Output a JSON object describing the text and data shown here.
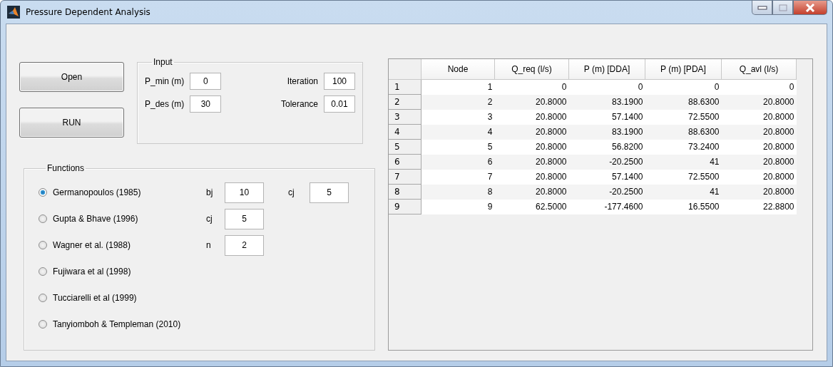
{
  "window": {
    "title": "Pressure Dependent Analysis"
  },
  "buttons": [
    "Open",
    "RUN"
  ],
  "input": {
    "title": "Input",
    "fields": [
      {
        "label": "P_min (m)",
        "value": "0"
      },
      {
        "label": "Iteration",
        "value": "100"
      },
      {
        "label": "P_des (m)",
        "value": "30"
      },
      {
        "label": "Tolerance",
        "value": "0.01"
      }
    ]
  },
  "functions": {
    "title": "Functions",
    "options": [
      {
        "label": "Germanopoulos (1985)",
        "selected": true,
        "params": [
          {
            "label": "bj",
            "value": "10"
          },
          {
            "label": "cj",
            "value": "5"
          }
        ]
      },
      {
        "label": "Gupta & Bhave (1996)",
        "selected": false,
        "params": [
          {
            "label": "cj",
            "value": "5"
          }
        ]
      },
      {
        "label": "Wagner et al. (1988)",
        "selected": false,
        "params": [
          {
            "label": "n",
            "value": "2"
          }
        ]
      },
      {
        "label": "Fujiwara et al (1998)",
        "selected": false
      },
      {
        "label": "Tucciarelli et al (1999)",
        "selected": false
      },
      {
        "label": "Tanyiomboh & Templeman (2010)",
        "selected": false
      }
    ]
  },
  "table": {
    "columns": [
      "Node",
      "Q_req (l/s)",
      "P (m) [DDA]",
      "P (m) [PDA]",
      "Q_avl (l/s)"
    ],
    "rows": [
      {
        "header": "1",
        "cells": [
          "1",
          "0",
          "0",
          "0",
          "0"
        ]
      },
      {
        "header": "2",
        "cells": [
          "2",
          "20.8000",
          "83.1900",
          "88.6300",
          "20.8000"
        ]
      },
      {
        "header": "3",
        "cells": [
          "3",
          "20.8000",
          "57.1400",
          "72.5500",
          "20.8000"
        ]
      },
      {
        "header": "4",
        "cells": [
          "4",
          "20.8000",
          "83.1900",
          "88.6300",
          "20.8000"
        ]
      },
      {
        "header": "5",
        "cells": [
          "5",
          "20.8000",
          "56.8200",
          "73.2400",
          "20.8000"
        ]
      },
      {
        "header": "6",
        "cells": [
          "6",
          "20.8000",
          "-20.2500",
          "41",
          "20.8000"
        ]
      },
      {
        "header": "7",
        "cells": [
          "7",
          "20.8000",
          "57.1400",
          "72.5500",
          "20.8000"
        ]
      },
      {
        "header": "8",
        "cells": [
          "8",
          "20.8000",
          "-20.2500",
          "41",
          "20.8000"
        ]
      },
      {
        "header": "9",
        "cells": [
          "9",
          "62.5000",
          "-177.4600",
          "16.5500",
          "22.8800"
        ]
      }
    ]
  }
}
